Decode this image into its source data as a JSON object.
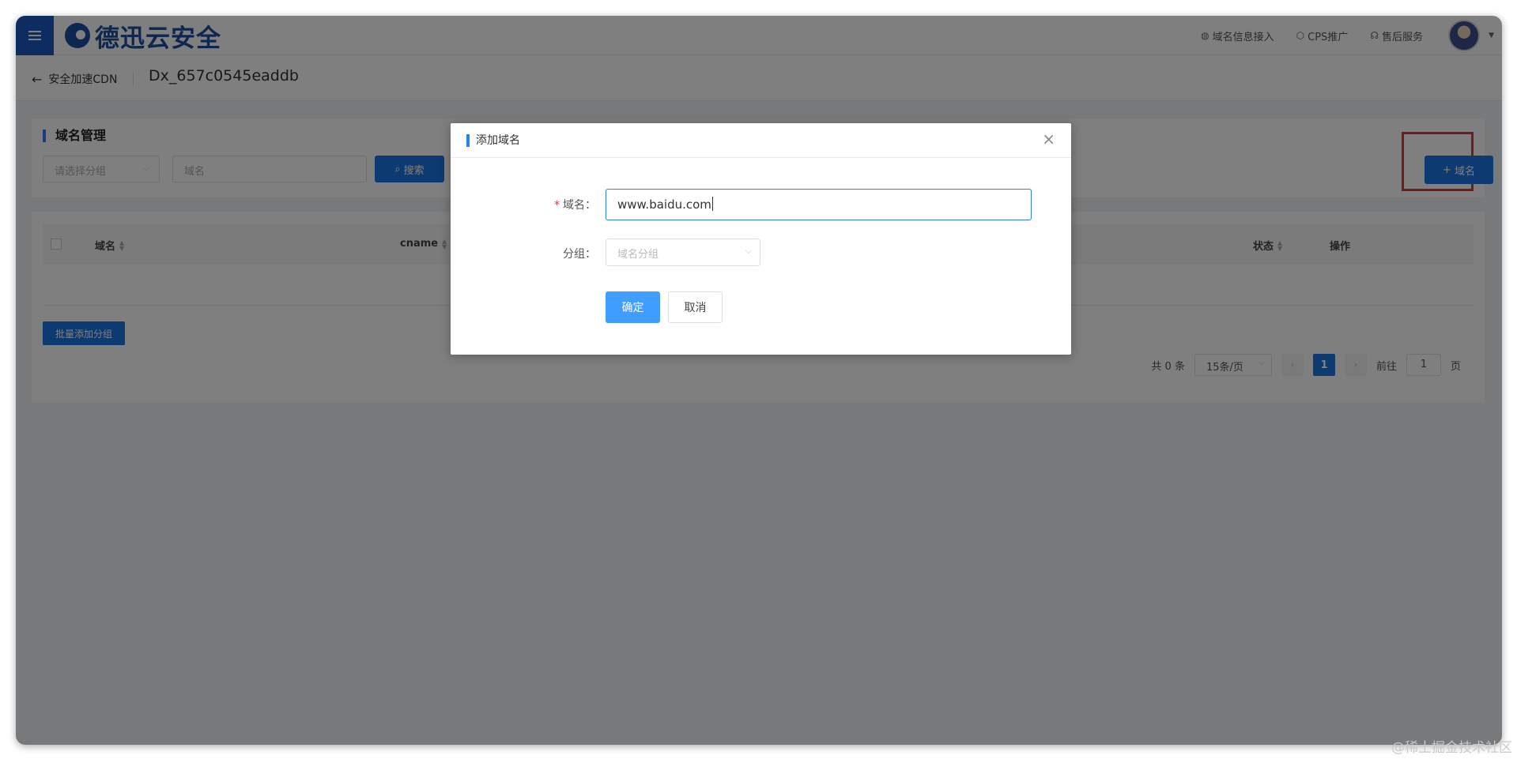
{
  "header": {
    "logo_text": "德迅云安全",
    "links": [
      {
        "label": "域名信息接入",
        "icon": "globe-icon"
      },
      {
        "label": "CPS推广",
        "icon": "cube-icon"
      },
      {
        "label": "售后服务",
        "icon": "headset-icon"
      }
    ]
  },
  "breadcrumb": {
    "back_label": "安全加速CDN",
    "instance_id": "Dx_657c0545eaddb"
  },
  "domain_mgmt": {
    "title": "域名管理",
    "group_select_placeholder": "请选择分组",
    "domain_input_placeholder": "域名",
    "search_label": "搜索",
    "add_label": "域名"
  },
  "table": {
    "columns": [
      "域名",
      "cname",
      "状态",
      "操作"
    ],
    "batch_label": "批量添加分组"
  },
  "pagination": {
    "total": "共 0 条",
    "page_size": "15条/页",
    "current_page": "1",
    "goto_prefix": "前往",
    "goto_value": "1",
    "goto_suffix": "页"
  },
  "modal": {
    "title": "添加域名",
    "domain_label": "域名：",
    "domain_value": "www.baidu.com",
    "group_label": "分组：",
    "group_placeholder": "域名分组",
    "ok_label": "确定",
    "cancel_label": "取消"
  },
  "watermark": "@稀土掘金技术社区",
  "colors": {
    "primary": "#1a75e0",
    "accent": "#409eff",
    "highlight": "#e8342e",
    "brand": "#1c4fa1"
  }
}
